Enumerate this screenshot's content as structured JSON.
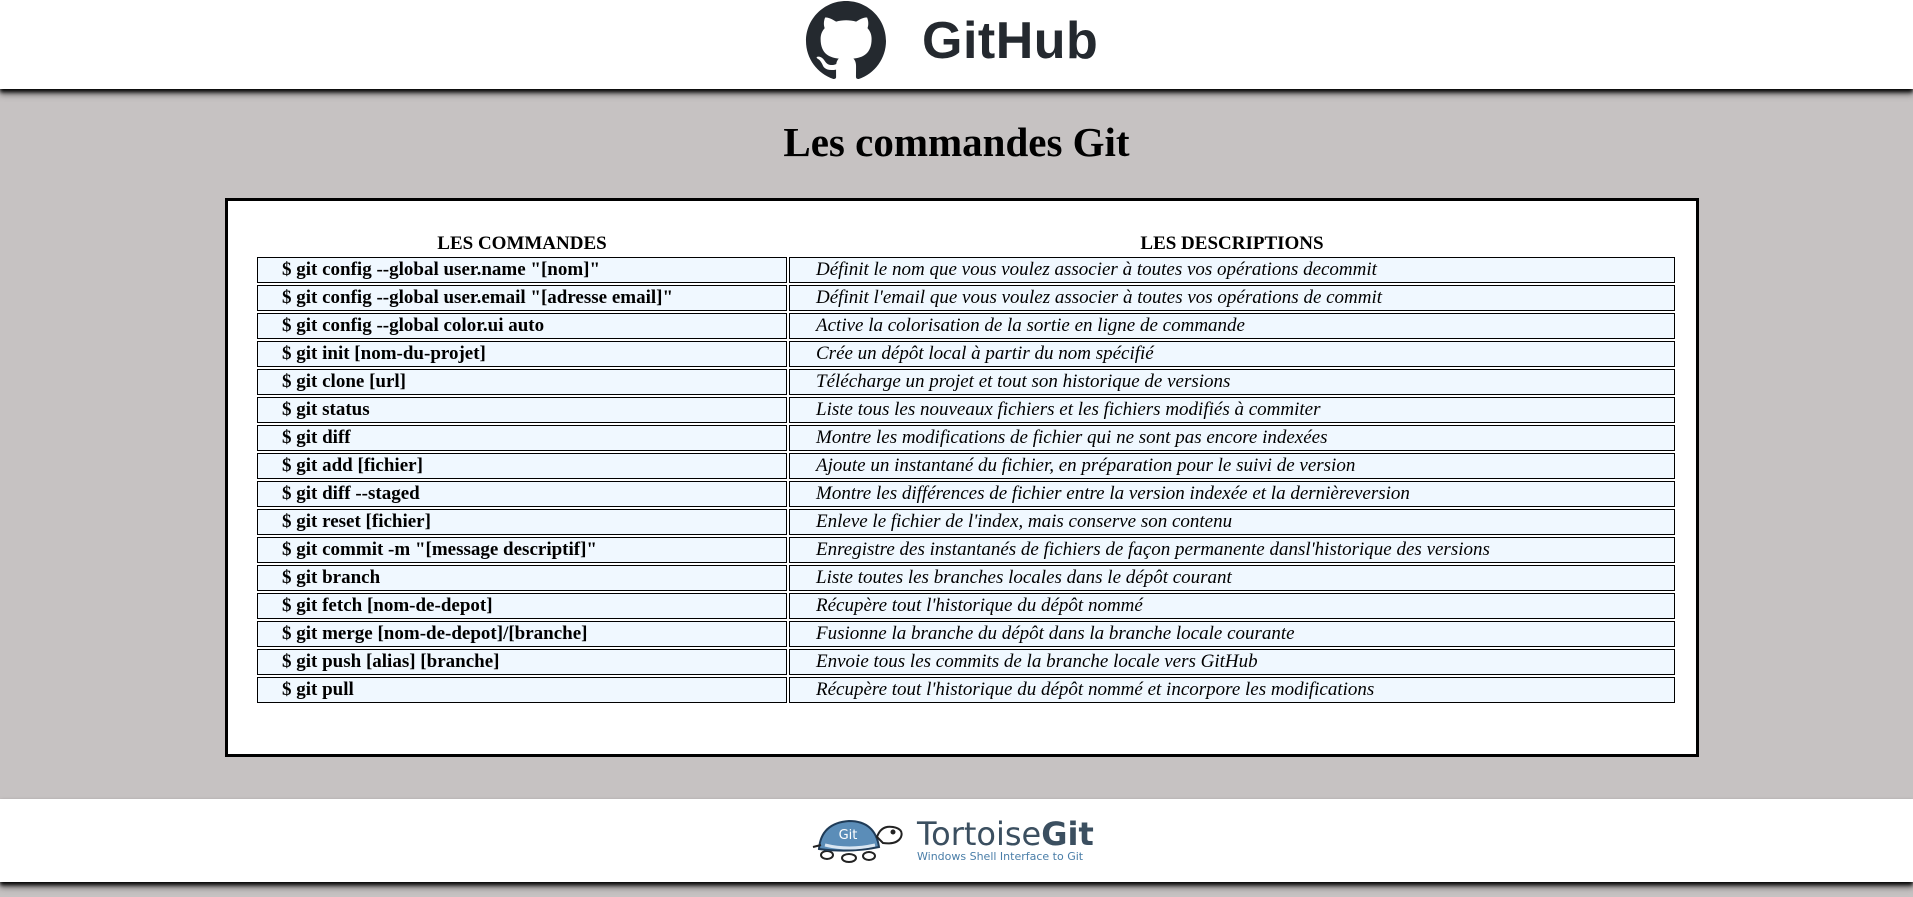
{
  "header": {
    "logo_text": "GitHub",
    "logo_icon": "github-octocat-icon"
  },
  "page_title": "Les commandes Git",
  "table": {
    "headers": [
      "LES COMMANDES",
      "LES DESCRIPTIONS"
    ],
    "rows": [
      {
        "cmd": "$ git config --global user.name \"[nom]\"",
        "desc": "Définit le nom que vous voulez associer à toutes vos opérations decommit"
      },
      {
        "cmd": "$ git config --global user.email \"[adresse email]\"",
        "desc": "Définit l'email que vous voulez associer à toutes vos opérations de commit"
      },
      {
        "cmd": "$ git config --global color.ui auto",
        "desc": "Active la colorisation de la sortie en ligne de commande"
      },
      {
        "cmd": "$ git init [nom-du-projet]",
        "desc": "Crée un dépôt local à partir du nom spécifié"
      },
      {
        "cmd": "$ git clone [url]",
        "desc": "Télécharge un projet et tout son historique de versions"
      },
      {
        "cmd": "$ git status",
        "desc": "Liste tous les nouveaux fichiers et les fichiers modifiés à commiter"
      },
      {
        "cmd": "$ git diff",
        "desc": "Montre les modifications de fichier qui ne sont pas encore indexées"
      },
      {
        "cmd": "$ git add [fichier]",
        "desc": "Ajoute un instantané du fichier, en préparation pour le suivi de version"
      },
      {
        "cmd": "$ git diff --staged",
        "desc": "Montre les différences de fichier entre la version indexée et la dernièreversion"
      },
      {
        "cmd": "$ git reset [fichier]",
        "desc": "Enleve le fichier de l'index, mais conserve son contenu"
      },
      {
        "cmd": "$ git commit -m \"[message descriptif]\"",
        "desc": "Enregistre des instantanés de fichiers de façon permanente dansl'historique des versions"
      },
      {
        "cmd": "$ git branch",
        "desc": "Liste toutes les branches locales dans le dépôt courant"
      },
      {
        "cmd": "$ git fetch [nom-de-depot]",
        "desc": "Récupère tout l'historique du dépôt nommé"
      },
      {
        "cmd": "$ git merge [nom-de-depot]/[branche]",
        "desc": "Fusionne la branche du dépôt dans la branche locale courante"
      },
      {
        "cmd": "$ git push [alias] [branche]",
        "desc": "Envoie tous les commits de la branche locale vers GitHub"
      },
      {
        "cmd": "$ git pull",
        "desc": "Récupère tout l'historique du dépôt nommé et incorpore les modifications"
      }
    ]
  },
  "footer": {
    "logo_icon": "tortoisegit-turtle-icon",
    "badge_text": "Git",
    "logo_name_prefix": "Tortoise",
    "logo_name_bold": "Git",
    "logo_tagline": "Windows Shell Interface to Git"
  },
  "colors": {
    "page_background": "#c6c2c2",
    "cell_background": "#f0f8ff",
    "github_dark": "#24292f"
  }
}
